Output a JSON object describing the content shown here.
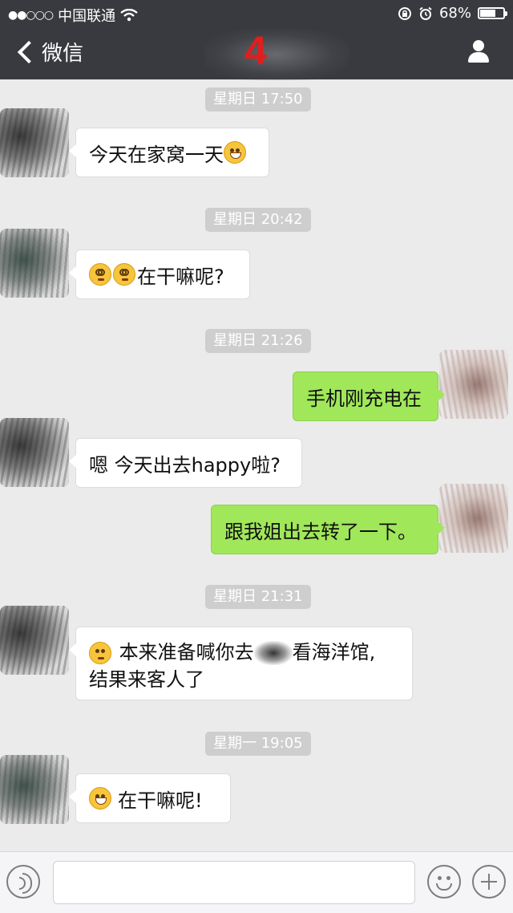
{
  "status_bar": {
    "signal": "●●○○○",
    "carrier": "中国联通",
    "wifi_icon": "wifi-icon",
    "battery_percent": "68%",
    "battery_level": 0.68
  },
  "nav": {
    "back_label": "微信",
    "title": "4"
  },
  "messages": {
    "t1": "星期日 17:50",
    "m1": "今天在家窝一天",
    "t2": "星期日 20:42",
    "m2": "在干嘛呢?",
    "t3": "星期日 21:26",
    "m3": "手机刚充电在",
    "m4": "嗯 今天出去happy啦?",
    "m5": "跟我姐出去转了一下。",
    "t4": "星期日 21:31",
    "m6a": "本来准备喊你去",
    "m6b": "看海洋馆,",
    "m6c": "结果来客人了",
    "t5": "星期一 19:05",
    "m7": "在干嘛呢!"
  },
  "input_bar": {
    "text_value": "",
    "voice_icon": "voice-icon",
    "emoji_icon": "emoji-icon",
    "plus_icon": "plus-icon"
  },
  "colors": {
    "nav_bg": "#383a3f",
    "chat_bg": "#ebebeb",
    "outgoing_bubble": "#a0e75a",
    "incoming_bubble": "#ffffff",
    "title_accent": "#e01e1e"
  }
}
